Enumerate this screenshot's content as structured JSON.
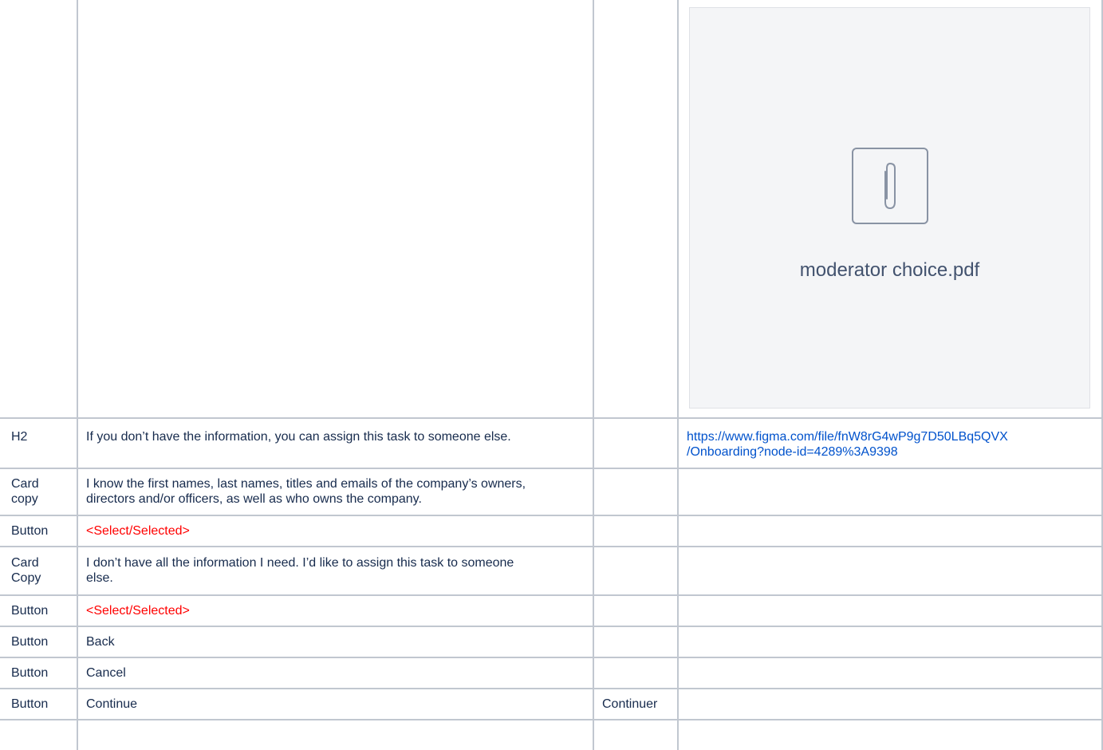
{
  "attachment": {
    "filename": "moderator choice.pdf",
    "icon": "paperclip-icon"
  },
  "rows": [
    {
      "type": "H2",
      "copy": "If you don’t have the information, you can assign this task to someone else.",
      "translation": "",
      "link_line1": "https://www.figma.com/file/fnW8rG4wP9g7D50LBq5QVX",
      "link_line2": "/Onboarding?node-id=4289%3A9398"
    },
    {
      "type_line1": "Card",
      "type_line2": "copy",
      "copy_line1": "I know the first names, last names, titles and emails of the company’s owners,",
      "copy_line2": "directors and/or officers, as well as who owns the company."
    },
    {
      "type": "Button",
      "copy": "<Select/Selected>"
    },
    {
      "type_line1": "Card",
      "type_line2": "Copy",
      "copy_line1": "I don’t have all the information I need. I’d like to assign this task to someone",
      "copy_line2": "else."
    },
    {
      "type": "Button",
      "copy": "<Select/Selected>"
    },
    {
      "type": "Button",
      "copy": "Back"
    },
    {
      "type": "Button",
      "copy": "Cancel"
    },
    {
      "type": "Button",
      "copy": "Continue",
      "translation": "Continuer"
    }
  ],
  "colors": {
    "border": "#c1c7d0",
    "placeholder_text": "#ff0000",
    "link": "#0052cc",
    "text": "#172b4d"
  }
}
